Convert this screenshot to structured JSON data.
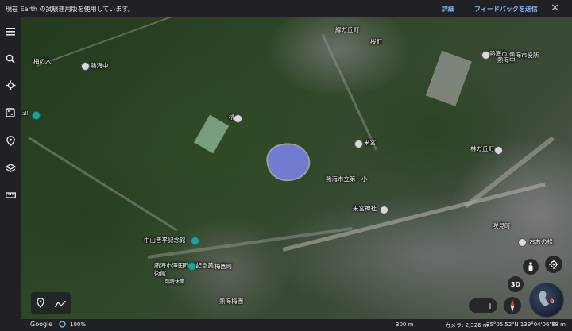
{
  "banner": {
    "message": "現在 Earth の試験運用版を使用しています。",
    "details_link": "詳細",
    "feedback_link": "フィードバックを送信",
    "close_icon": "close-icon"
  },
  "sidebar": {
    "items": [
      {
        "name": "menu-icon"
      },
      {
        "name": "search-icon"
      },
      {
        "name": "voyager-icon"
      },
      {
        "name": "random-icon"
      },
      {
        "name": "projects-icon"
      },
      {
        "name": "map-style-icon"
      },
      {
        "name": "measure-icon"
      }
    ]
  },
  "map": {
    "labels": {
      "l1": "緑ガ丘町",
      "l2": "熱海市",
      "l3": "熱海市役所",
      "l4": "熱海中",
      "l5": "来宮",
      "l6": "熱海市立第一小",
      "l7": "来宮神社",
      "l8": "林ガ丘町",
      "l9": "中山晋平記念館",
      "l10": "熱海市澤田政廣記念美術館",
      "l11": "臨時休業",
      "l12": "梅園町",
      "l13": "熱海梅園",
      "l14": "咲見町",
      "l15": "おおの松",
      "l16": "桃山",
      "l17": "梅の木",
      "l18": "熱海中",
      "l19": "桜町",
      "l20": "all"
    }
  },
  "controls": {
    "three_d_label": "3D",
    "zoom_minus": "−",
    "zoom_plus": "+"
  },
  "status": {
    "google": "Google",
    "zoom_percent": "100%",
    "scale": "300 m",
    "camera": "カメラ: 2,326 m",
    "coords": "35°05'52\"N 139°04'06\"E",
    "elevation": "78 m"
  }
}
